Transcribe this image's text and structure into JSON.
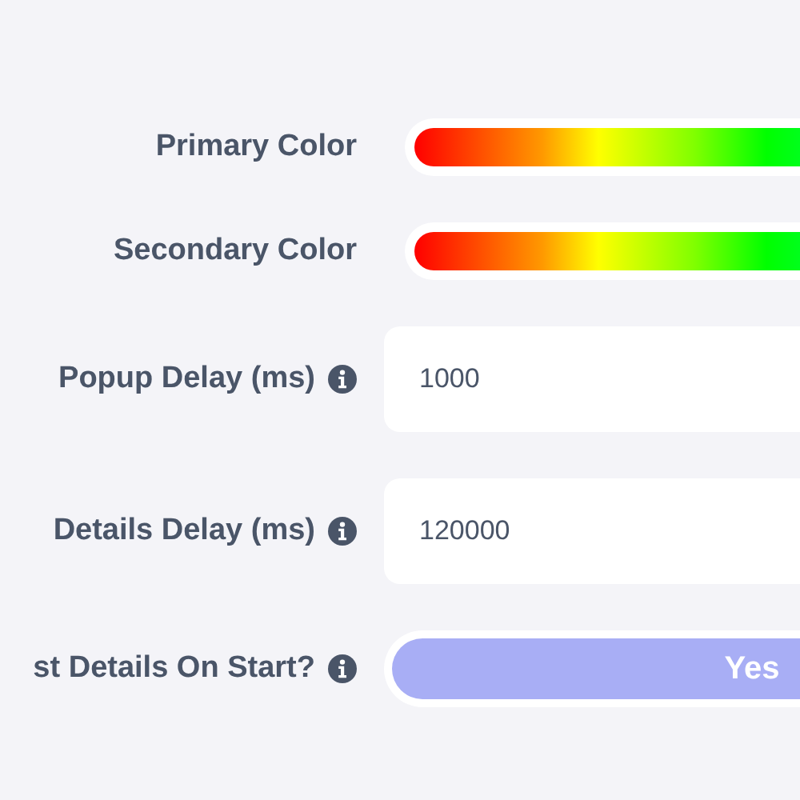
{
  "settings": [
    {
      "kind": "color",
      "label": "Primary Color"
    },
    {
      "kind": "color",
      "label": "Secondary Color"
    },
    {
      "kind": "number",
      "label": "Popup Delay (ms)",
      "value": "1000"
    },
    {
      "kind": "number",
      "label": "Details Delay (ms)",
      "value": "120000"
    },
    {
      "kind": "toggle",
      "label": "st Details On Start?",
      "on": true,
      "state_label": "Yes"
    }
  ]
}
